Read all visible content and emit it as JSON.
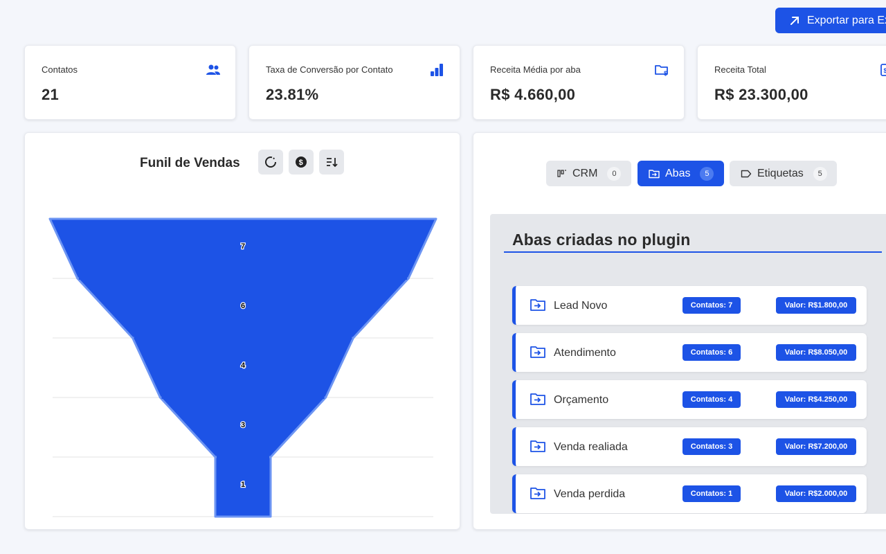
{
  "export_button": {
    "label": "Exportar para Excel",
    "icon": "arrow-up-right-icon"
  },
  "stats": [
    {
      "label": "Contatos",
      "value": "21",
      "icon": "users-icon"
    },
    {
      "label": "Taxa de Conversão por Contato",
      "value": "23.81%",
      "icon": "bar-chart-icon"
    },
    {
      "label": "Receita Média por aba",
      "value": "R$ 4.660,00",
      "icon": "folder-dollar-icon"
    },
    {
      "label": "Receita Total",
      "value": "R$ 23.300,00",
      "icon": "receipt-icon"
    }
  ],
  "funnel": {
    "title": "Funil de Vendas",
    "tools": [
      "refresh-icon",
      "dollar-circle-icon",
      "sort-icon"
    ],
    "color": "#1d53e6"
  },
  "chart_data": {
    "type": "funnel",
    "categories": [
      "Lead Novo",
      "Atendimento",
      "Orçamento",
      "Venda realiada",
      "Venda perdida"
    ],
    "values": [
      7,
      6,
      4,
      3,
      1
    ],
    "grid": true
  },
  "tabs": [
    {
      "label": "CRM",
      "count": "0",
      "icon": "kanban-icon",
      "active": false
    },
    {
      "label": "Abas",
      "count": "5",
      "icon": "folder-icon",
      "active": true
    },
    {
      "label": "Etiquetas",
      "count": "5",
      "icon": "tag-icon",
      "active": false
    }
  ],
  "panel": {
    "title": "Abas criadas no plugin",
    "rows": [
      {
        "name": "Lead Novo",
        "contacts": "Contatos: 7",
        "value": "Valor: R$1.800,00"
      },
      {
        "name": "Atendimento",
        "contacts": "Contatos: 6",
        "value": "Valor: R$8.050,00"
      },
      {
        "name": "Orçamento",
        "contacts": "Contatos: 4",
        "value": "Valor: R$4.250,00"
      },
      {
        "name": "Venda realiada",
        "contacts": "Contatos: 3",
        "value": "Valor: R$7.200,00"
      },
      {
        "name": "Venda perdida",
        "contacts": "Contatos: 1",
        "value": "Valor: R$2.000,00"
      }
    ]
  },
  "colors": {
    "accent": "#1d53e6",
    "background": "#f4f6fb"
  }
}
